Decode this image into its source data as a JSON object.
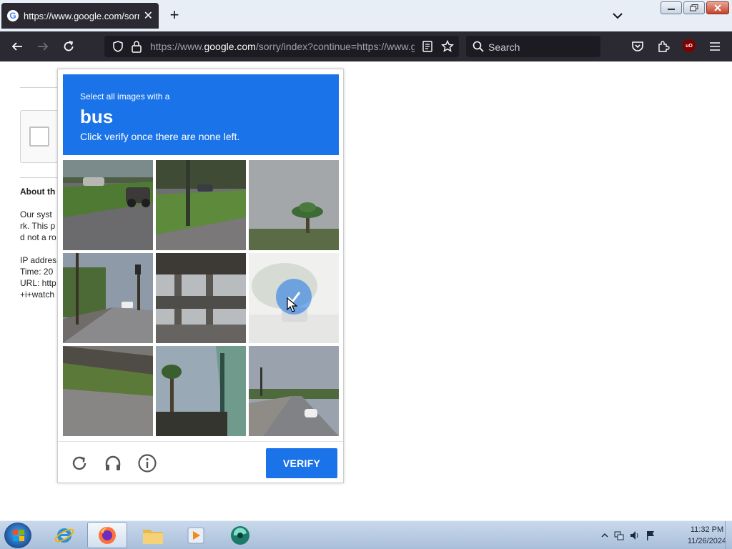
{
  "browser": {
    "tab_title": "https://www.google.com/sorry/index?continue=https://www.",
    "tab_favicon": "G",
    "url_prefix": "https://www.",
    "url_host": "google.com",
    "url_rest": "/sorry/index?continue=https://www.google.com/search",
    "search_placeholder": "Search",
    "ublock_badge": "uO"
  },
  "page": {
    "about_heading": "About th",
    "para_line1": "Our syst",
    "para_line2": "rk. This p",
    "para_line3": "d not a ro",
    "ip_line": "IP addres",
    "time_line": "Time: 20",
    "url_line": "URL: http",
    "url_line2": "+i+watch"
  },
  "captcha": {
    "instruction": "Select all images with a",
    "target": "bus",
    "sub_instruction": "Click verify once there are none left.",
    "verify_label": "VERIFY",
    "selected_tile": 6,
    "accent_color": "#1a73e8"
  },
  "taskbar": {
    "time": "11:32 PM",
    "date": "11/26/2024"
  }
}
